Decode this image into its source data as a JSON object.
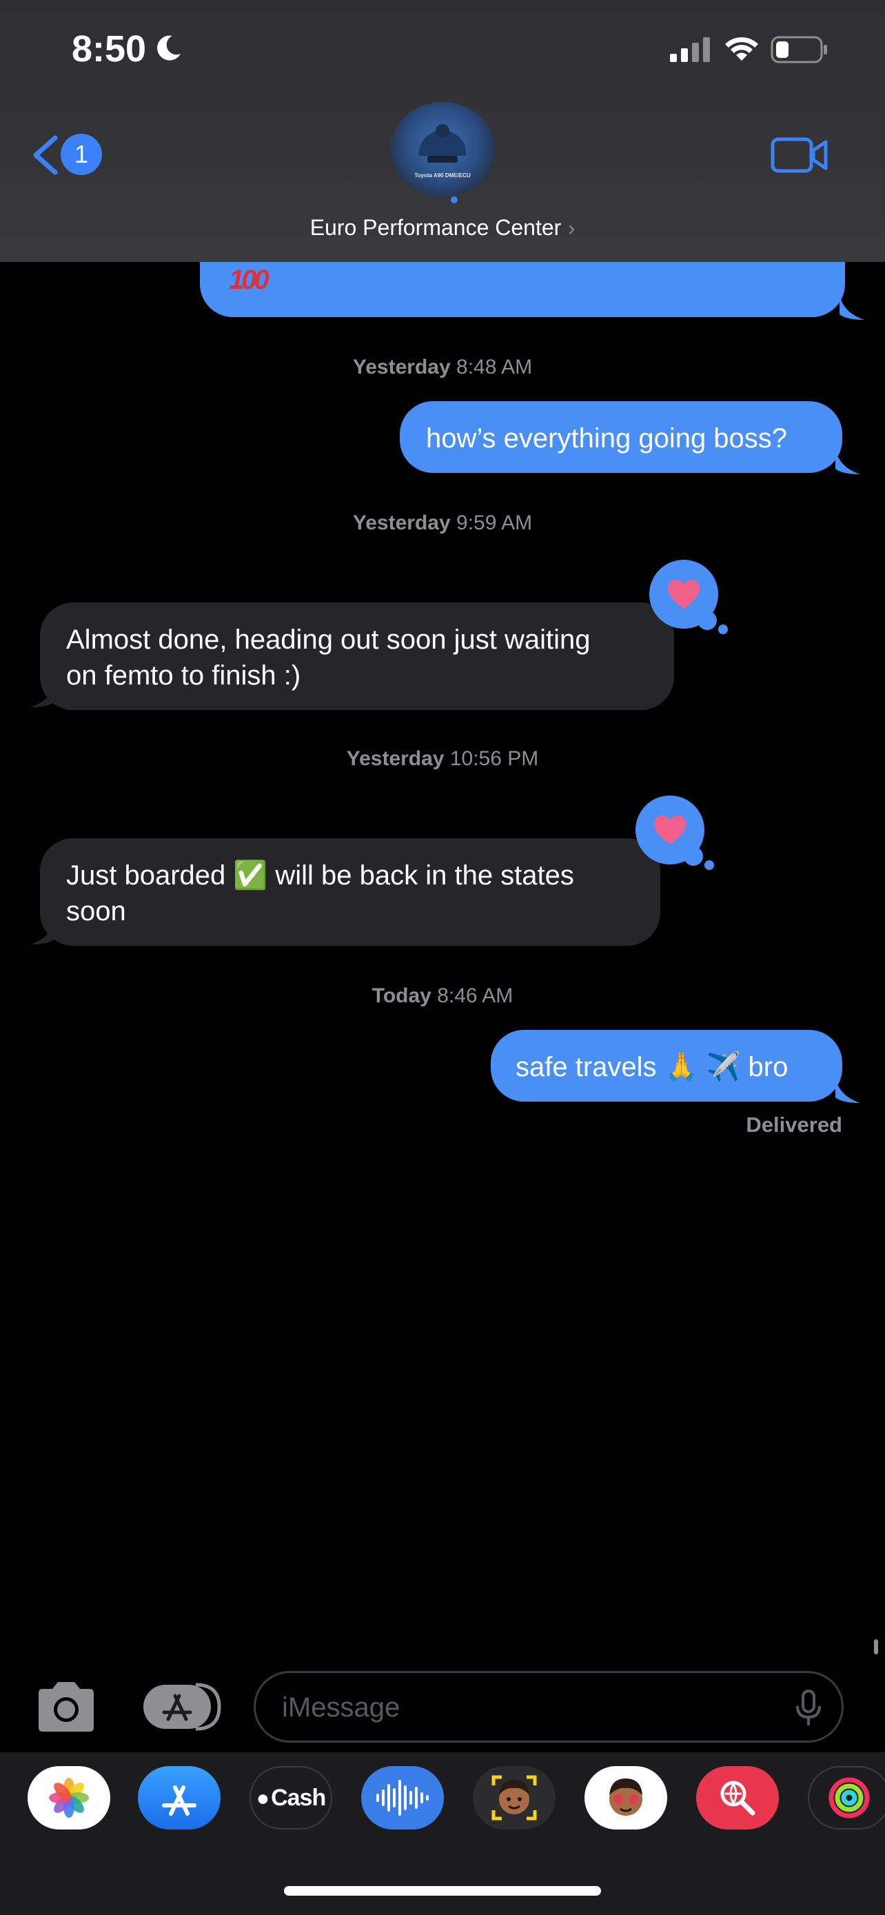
{
  "status_bar": {
    "time": "8:50"
  },
  "header": {
    "back_badge": "1",
    "contact_name": "Euro Performance Center",
    "chevron": "›",
    "avatar_caption": "Toyota A90 DME/ECU"
  },
  "messages": {
    "previous_emoji": "100",
    "items": [
      {
        "timestamp_day": "Yesterday",
        "timestamp_time": "8:48 AM",
        "direction": "outgoing",
        "text": "how’s everything going boss?"
      },
      {
        "timestamp_day": "Yesterday",
        "timestamp_time": "9:59 AM",
        "direction": "incoming",
        "line1": "Almost done, heading out soon just waiting",
        "line2": "on femto to finish :)",
        "tapback": "heart-icon"
      },
      {
        "timestamp_day": "Yesterday",
        "timestamp_time": "10:56 PM",
        "direction": "incoming",
        "line1_a": "Just boarded",
        "line1_emoji": "✅",
        "line1_b": "will be back in the states",
        "line2": "soon",
        "tapback": "heart-icon"
      },
      {
        "timestamp_day": "Today",
        "timestamp_time": "8:46 AM",
        "direction": "outgoing",
        "text_a": "safe travels",
        "emoji_a": "🙏",
        "emoji_b": "✈️",
        "text_b": "bro"
      }
    ],
    "delivered": "Delivered"
  },
  "input_bar": {
    "placeholder": "iMessage"
  },
  "app_drawer": {
    "apps": [
      "photos-icon",
      "app-store-icon",
      "apple-cash-icon",
      "voice-memo-icon",
      "memoji-icon",
      "memoji-stickers-icon",
      "web-search-icon",
      "activity-icon"
    ],
    "cash_label": "Cash"
  },
  "colors": {
    "accent": "#4a8ff5",
    "incoming_bubble": "#262629",
    "heart": "#f0608a"
  }
}
